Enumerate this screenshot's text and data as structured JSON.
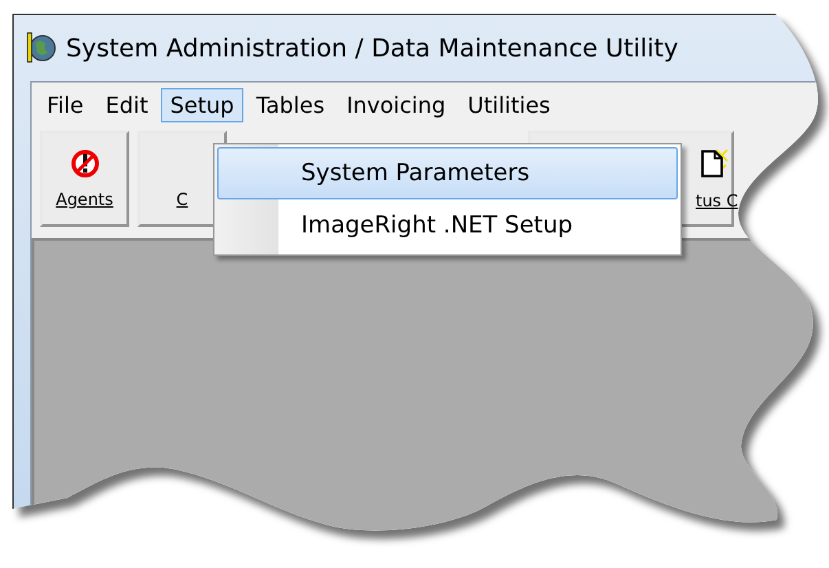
{
  "window": {
    "title": "System Administration / Data Maintenance Utility"
  },
  "menu_bar": [
    {
      "label": "File",
      "selected": false
    },
    {
      "label": "Edit",
      "selected": false
    },
    {
      "label": "Setup",
      "selected": true
    },
    {
      "label": "Tables",
      "selected": false
    },
    {
      "label": "Invoicing",
      "selected": false
    },
    {
      "label": "Utilities",
      "selected": false
    }
  ],
  "toolbar": [
    {
      "label": "Agents",
      "kind": "no-entry"
    },
    {
      "label": "C",
      "kind": "none"
    },
    {
      "label": "tus C",
      "kind": "document"
    }
  ],
  "dropdown": [
    {
      "label": "System Parameters",
      "selected": true
    },
    {
      "label": "ImageRight .NET Setup",
      "selected": false
    }
  ]
}
